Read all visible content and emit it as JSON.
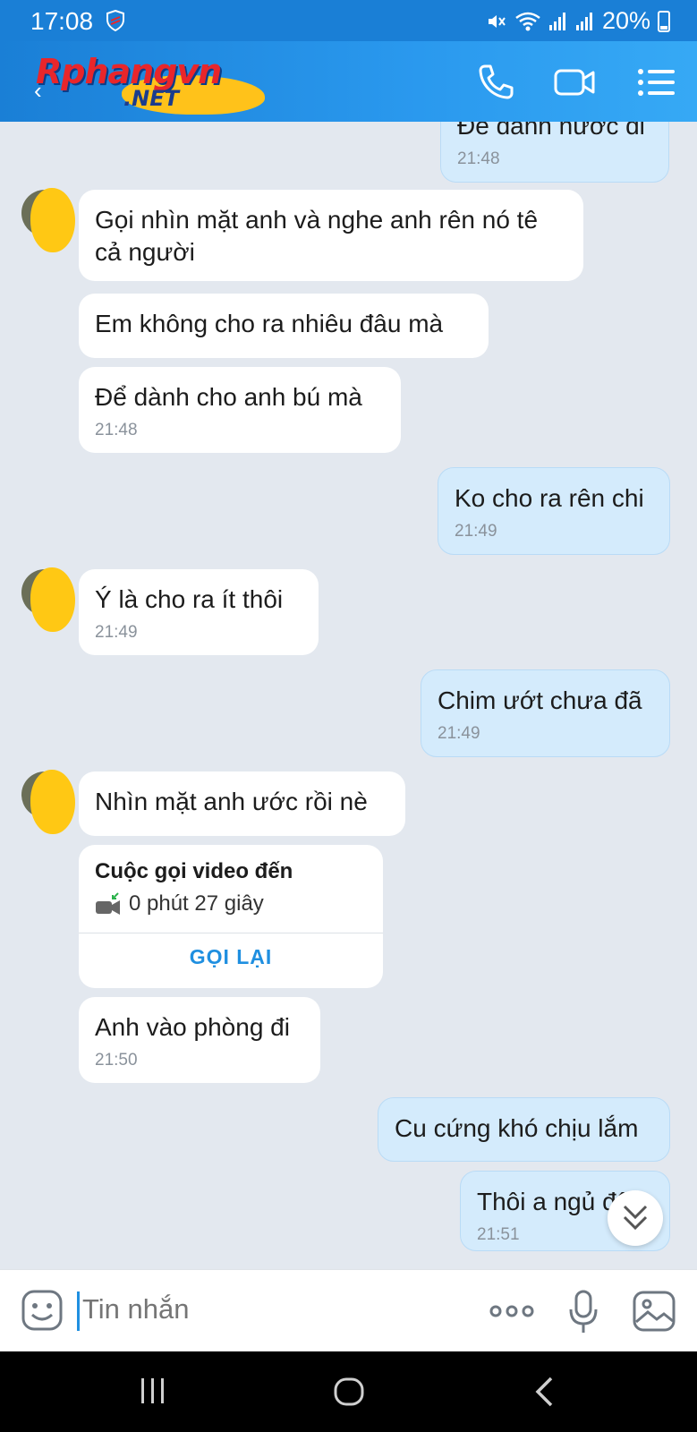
{
  "status_bar": {
    "time": "17:08",
    "battery": "20%",
    "icons": [
      "shield-icon",
      "mute-icon",
      "wifi-icon",
      "signal-icon",
      "signal-icon",
      "battery-icon"
    ]
  },
  "header": {
    "logo_line1": "Rphangvn",
    "logo_line2": ".NET",
    "back_icon": "‹",
    "buttons": [
      "phone-call-icon",
      "video-call-icon",
      "menu-list-icon"
    ]
  },
  "messages": [
    {
      "side": "out",
      "text": "Để dành nước đi",
      "time": "21:48"
    },
    {
      "side": "in",
      "text": "Gọi nhìn mặt anh và nghe anh rên nó tê cả người",
      "time": ""
    },
    {
      "side": "in",
      "text": "Em không cho ra nhiêu đâu mà",
      "time": ""
    },
    {
      "side": "in",
      "text": "Để dành cho anh bú mà",
      "time": "21:48"
    },
    {
      "side": "out",
      "text": "Ko cho ra rên chi",
      "time": "21:49"
    },
    {
      "side": "in",
      "text": "Ý là cho ra ít thôi",
      "time": "21:49"
    },
    {
      "side": "out",
      "text": "Chim ướt chưa đã",
      "time": "21:49"
    },
    {
      "side": "in",
      "text": "Nhìn mặt anh ước rồi nè",
      "time": ""
    },
    {
      "side": "in",
      "text": "Anh vào phòng đi",
      "time": "21:50"
    },
    {
      "side": "out",
      "text": "Cu cứng khó chịu lắm",
      "time": ""
    },
    {
      "side": "out",
      "text": "Thôi a ngủ đây",
      "time": "21:51"
    }
  ],
  "call_card": {
    "title": "Cuộc gọi video đến",
    "duration": "0 phút 27 giây",
    "action": "GỌI LẠI"
  },
  "composer": {
    "placeholder": "Tin nhắn"
  },
  "colors": {
    "header": "#1a7fd6",
    "chat_bg": "#e3e8ef",
    "incoming": "#ffffff",
    "outgoing": "#d4ebfc",
    "accent": "#1f8fe0"
  }
}
